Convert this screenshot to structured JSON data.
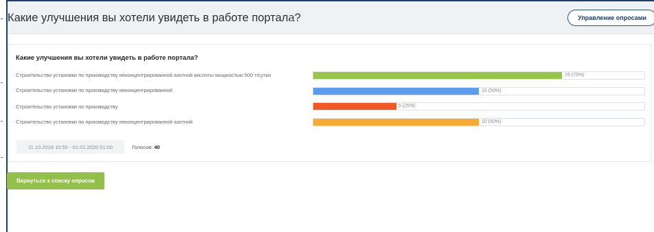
{
  "header": {
    "title": "Какие улучшения вы хотели увидеть в работе портала?",
    "star_icon": "☆",
    "manage_button": "Управление опросами"
  },
  "poll": {
    "question": "Какие улучшения вы хотели увидеть в работе портала?",
    "answers": [
      {
        "label": "Строительство установки по производству неконцентрированной азотной кислоты мощностью 500 т/сутки",
        "result": "15 (75%)",
        "percent": 75,
        "color": "#96c54a"
      },
      {
        "label": "Строительство установки по производству неконцентрированной",
        "result": "10 (50%)",
        "percent": 50,
        "color": "#5b9cf0"
      },
      {
        "label": "Строительство установки по производству",
        "result": "5 (25%)",
        "percent": 25,
        "color": "#f15a24"
      },
      {
        "label": "Строительство установки по производству неконцентрированной азотной",
        "result": "10 (50%)",
        "percent": 50,
        "color": "#f5ac35"
      }
    ],
    "date_range": "11.10.2018 10:55 - 01.01.2020 01:00",
    "votes_label": "Голосов:",
    "votes_count": "40"
  },
  "back_button": "Вернуться к списку опросов"
}
